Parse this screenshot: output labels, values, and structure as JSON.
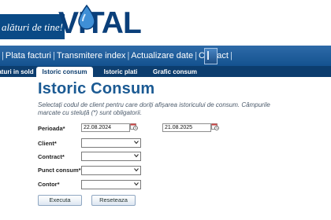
{
  "banner": {
    "slogan": "alături de tine!",
    "logo_text": "VITAL",
    "brand_color": "#0a3f7a"
  },
  "topnav": {
    "items": [
      "Plata facturi",
      "Transmitere index",
      "Actualizare date",
      "Contact"
    ]
  },
  "tabs": [
    {
      "label": "aturi in sold",
      "active": false
    },
    {
      "label": "Istoric consum",
      "active": true
    },
    {
      "label": "Istoric plati",
      "active": false
    },
    {
      "label": "Grafic consum",
      "active": false
    }
  ],
  "page": {
    "title": "Istoric Consum",
    "description": "Selectați codul de client pentru care doriți afișarea istoricului de consum. Câmpurile marcate cu steluță (*) sunt obligatorii."
  },
  "form": {
    "period_label": "Perioada*",
    "date_from": "22.08.2024",
    "date_to": "21.08.2025",
    "client_label": "Client*",
    "contract_label": "Contract*",
    "punct_label": "Punct consum*",
    "contor_label": "Contor*"
  },
  "buttons": {
    "execute": "Executa",
    "reset": "Reseteaza"
  }
}
